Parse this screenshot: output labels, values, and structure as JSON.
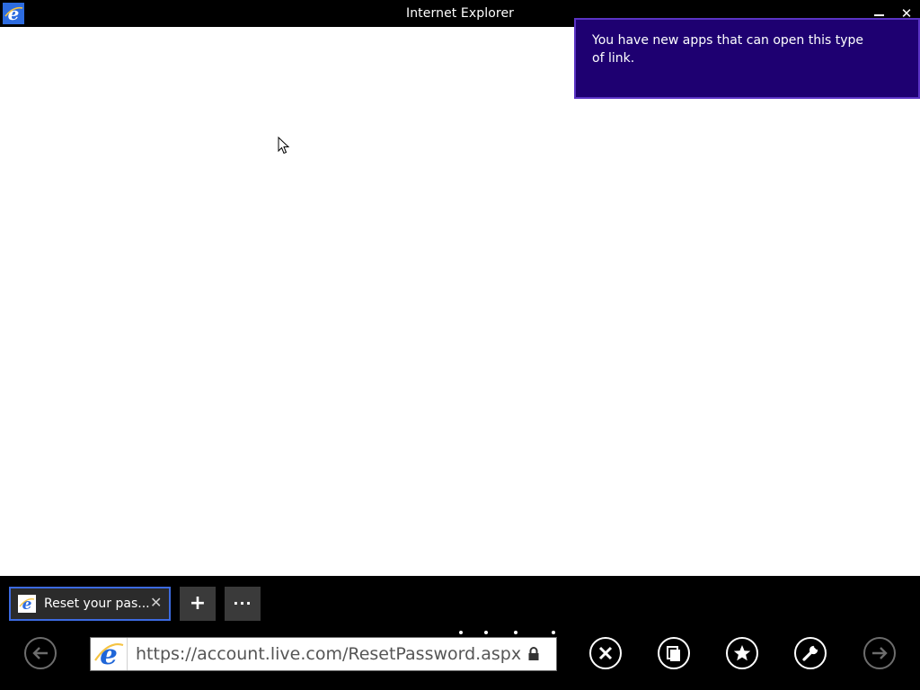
{
  "window": {
    "title": "Internet Explorer",
    "minimize_label": "",
    "close_label": "✕"
  },
  "notification": {
    "text": "You have new apps that can open this type of link."
  },
  "tabs": [
    {
      "label": "Reset your pas...",
      "close_label": "✕"
    }
  ],
  "tab_controls": {
    "add_label": "+",
    "more_label": "···"
  },
  "address_bar": {
    "url": "https://account.live.com/ResetPassword.aspx"
  },
  "icons": {
    "app": "ie-logo-icon",
    "back": "back-arrow-icon",
    "forward": "forward-arrow-icon",
    "stop": "stop-icon",
    "tabs": "switch-tabs-icon",
    "favorites": "star-icon",
    "tools": "wrench-icon",
    "lock": "lock-icon"
  },
  "colors": {
    "notification_bg": "#1e0071",
    "tab_border": "#3c6ae0",
    "appbar_bg": "#000000"
  }
}
